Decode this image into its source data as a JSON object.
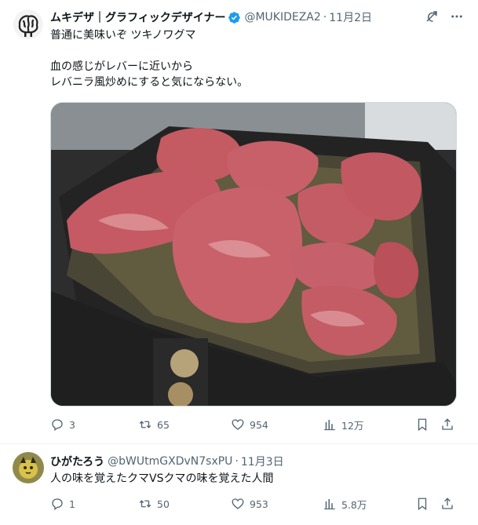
{
  "post": {
    "author_name": "ムキデザ｜グラフィックデザイナー",
    "handle": "@MUKIDEZA2",
    "date": "11月2日",
    "text": "普通に美味いぞ ツキノワグマ\n\n血の感じがレバーに近いから\nレバニラ風炒めにすると気にならない。",
    "counts": {
      "replies": "3",
      "reposts": "65",
      "likes": "954",
      "views": "12万"
    },
    "icons": [
      "grok-icon",
      "more-icon",
      "verified-badge-icon",
      "reply-icon",
      "repost-icon",
      "like-icon",
      "views-icon",
      "bookmark-icon",
      "share-icon"
    ],
    "media": "photo-meat-on-grill-pan"
  },
  "reply": {
    "author_name": "ひがたろう",
    "handle": "@bWUtmGXDvN7sxPU",
    "date": "11月3日",
    "text": "人の味を覚えたクマVSクマの味を覚えた人間",
    "counts": {
      "replies": "1",
      "reposts": "50",
      "likes": "953",
      "views": "5.8万"
    }
  },
  "colors": {
    "verified": "#1d9bf0",
    "muted": "#536471",
    "text": "#0f1419",
    "border": "#eff3f4"
  }
}
